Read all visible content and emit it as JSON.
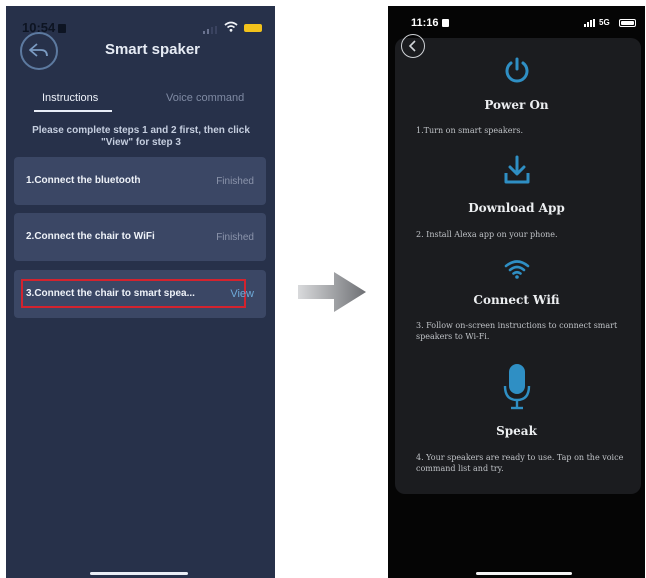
{
  "left_screen": {
    "status_bar": {
      "time": "10:54"
    },
    "header": {
      "title": "Smart spaker"
    },
    "tabs": [
      {
        "label": "Instructions",
        "active": true
      },
      {
        "label": "Voice command",
        "active": false
      }
    ],
    "instructions_text": "Please complete steps 1 and 2 first, then click \"View\" for step 3",
    "steps": [
      {
        "label": "1.Connect the bluetooth",
        "status": "Finished"
      },
      {
        "label": "2.Connect the chair to WiFi",
        "status": "Finished"
      },
      {
        "label": "3.Connect the chair to smart spea...",
        "status": "View"
      }
    ]
  },
  "right_screen": {
    "status_bar": {
      "time": "11:16",
      "network": "5G"
    },
    "sections": [
      {
        "icon": "power-icon",
        "title": "Power On",
        "text": "1.Turn on smart speakers."
      },
      {
        "icon": "download-icon",
        "title": "Download App",
        "text": "2. Install Alexa app on your phone."
      },
      {
        "icon": "wifi-icon",
        "title": "Connect Wifi",
        "text": "3. Follow on-screen instructions to connect smart speakers to Wi-Fi."
      },
      {
        "icon": "microphone-icon",
        "title": "Speak",
        "text": "4. Your speakers are ready to use. Tap on the voice command list and try."
      }
    ]
  },
  "colors": {
    "left_background": "#27314a",
    "card_background": "#3b4765",
    "highlight": "#d3232e",
    "accent_blue": "#2f8fc4",
    "right_background": "#050505",
    "panel_background": "#1b1c1f"
  }
}
